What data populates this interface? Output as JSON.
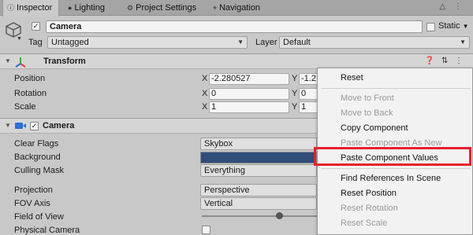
{
  "tabs": [
    {
      "label": "Inspector",
      "icon": "info-icon"
    },
    {
      "label": "Lighting",
      "icon": "bulb-icon"
    },
    {
      "label": "Project Settings",
      "icon": "gear-icon"
    },
    {
      "label": "Navigation",
      "icon": "nav-icon"
    }
  ],
  "header": {
    "name": "Camera",
    "static_label": "Static",
    "tag_label": "Tag",
    "tag_value": "Untagged",
    "layer_label": "Layer",
    "layer_value": "Default"
  },
  "transform": {
    "title": "Transform",
    "rows": [
      {
        "label": "Position",
        "x": "-2.280527",
        "y": "-1.2"
      },
      {
        "label": "Rotation",
        "x": "0",
        "y": "0"
      },
      {
        "label": "Scale",
        "x": "1",
        "y": "1"
      }
    ],
    "axis_x": "X",
    "axis_y": "Y"
  },
  "camera": {
    "title": "Camera",
    "clear_flags_label": "Clear Flags",
    "clear_flags_value": "Skybox",
    "background_label": "Background",
    "background_color": "#314d79",
    "culling_mask_label": "Culling Mask",
    "culling_mask_value": "Everything",
    "projection_label": "Projection",
    "projection_value": "Perspective",
    "fov_axis_label": "FOV Axis",
    "fov_axis_value": "Vertical",
    "field_of_view_label": "Field of View",
    "physical_camera_label": "Physical Camera"
  },
  "context_menu": {
    "items": [
      {
        "label": "Reset",
        "enabled": true
      },
      {
        "label": "Move to Front",
        "enabled": false
      },
      {
        "label": "Move to Back",
        "enabled": false
      },
      {
        "label": "Copy Component",
        "enabled": true
      },
      {
        "label": "Paste Component As New",
        "enabled": false
      },
      {
        "label": "Paste Component Values",
        "enabled": true
      },
      {
        "label": "Find References In Scene",
        "enabled": true
      },
      {
        "label": "Reset Position",
        "enabled": true
      },
      {
        "label": "Reset Rotation",
        "enabled": false
      },
      {
        "label": "Reset Scale",
        "enabled": false
      }
    ],
    "highlight_color": "#e8212b"
  }
}
